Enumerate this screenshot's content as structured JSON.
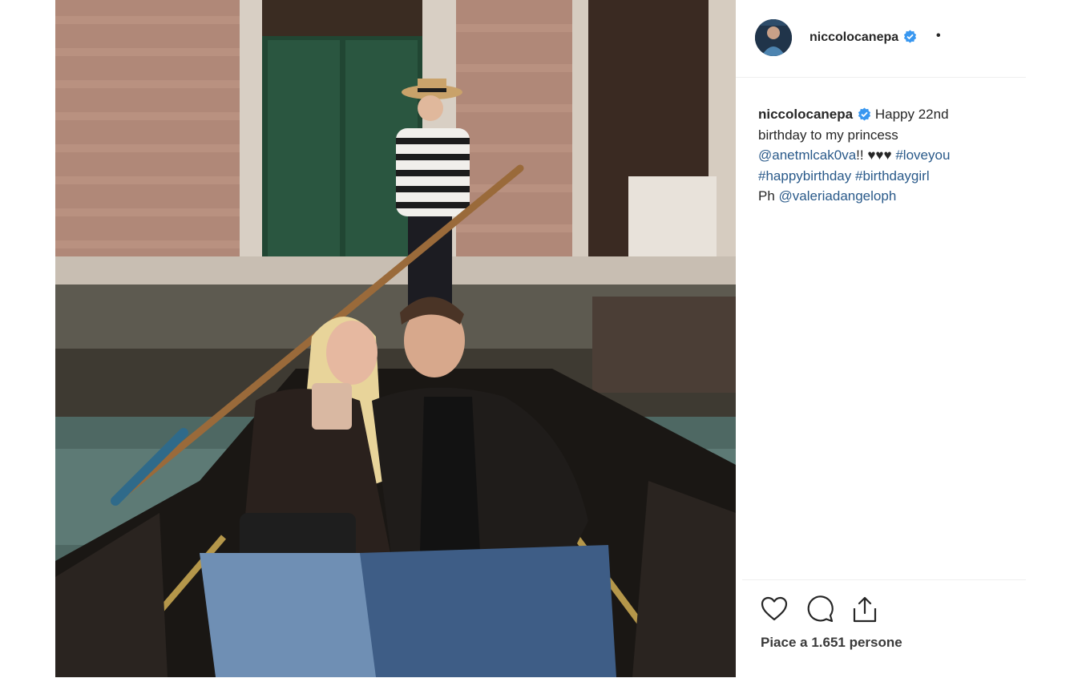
{
  "post": {
    "username": "niccolocanepa",
    "verified": true,
    "separator": "•",
    "caption": {
      "username": "niccolocanepa",
      "text_1": "Happy 22nd birthday to my princess",
      "mention_1": "@anetmlcak0va",
      "text_2": "!! ♥♥♥",
      "hashtag_1": "#loveyou",
      "hashtag_2": "#happybirthday",
      "hashtag_3": "#birthdaygirl",
      "text_3": "Ph",
      "mention_2": "@valeriadangeloph"
    },
    "likes_text": "Piace a 1.651 persone"
  },
  "icons": {
    "like": "heart-outline-icon",
    "comment": "speech-bubble-icon",
    "share": "share-upload-icon",
    "verified": "verified-badge-icon"
  },
  "colors": {
    "verified_blue": "#3897f0",
    "link_blue": "#2a5a8a",
    "text": "#262626"
  }
}
